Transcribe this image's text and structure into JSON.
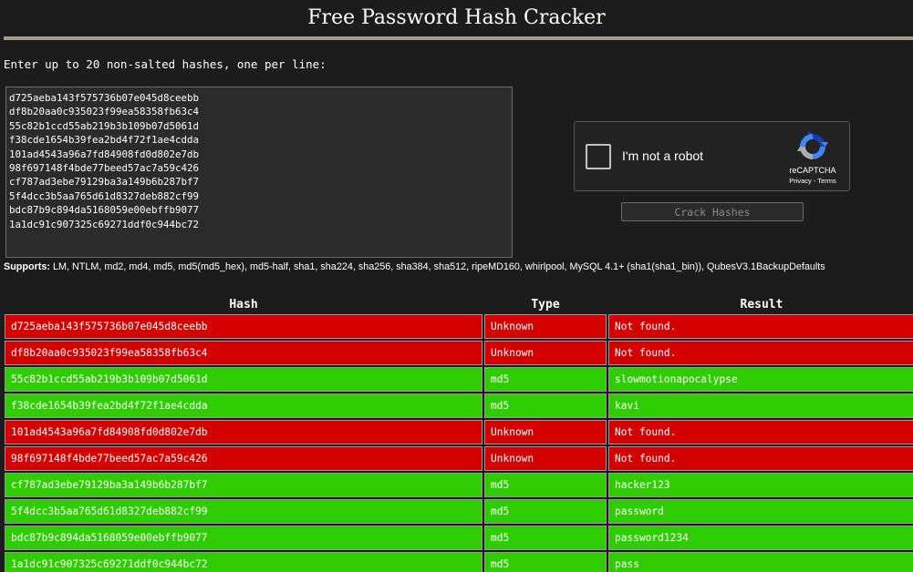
{
  "page": {
    "title": "Free Password Hash Cracker",
    "instructions": "Enter up to 20 non-salted hashes, one per line:"
  },
  "hash_input": {
    "value": "d725aeba143f575736b07e045d8ceebb\ndf8b20aa0c935023f99ea58358fb63c4\n55c82b1ccd55ab219b3b109b07d5061d\nf38cde1654b39fea2bd4f72f1ae4cdda\n101ad4543a96a7fd84908fd0d802e7db\n98f697148f4bde77beed57ac7a59c426\ncf787ad3ebe79129ba3a149b6b287bf7\n5f4dcc3b5aa765d61d8327deb882cf99\nbdc87b9c894da5168059e00ebffb9077\n1a1dc91c907325c69271ddf0c944bc72"
  },
  "captcha": {
    "label": "I'm not a robot",
    "brand": "reCAPTCHA",
    "links": "Privacy - Terms",
    "icon": "recaptcha-logo"
  },
  "crack_button": {
    "label": "Crack Hashes"
  },
  "supports": {
    "label": "Supports:",
    "text": "LM, NTLM, md2, md4, md5, md5(md5_hex), md5-half, sha1, sha224, sha256, sha384, sha512, ripeMD160, whirlpool, MySQL 4.1+ (sha1(sha1_bin)), QubesV3.1BackupDefaults"
  },
  "results": {
    "headers": {
      "hash": "Hash",
      "type": "Type",
      "result": "Result"
    },
    "rows": [
      {
        "hash": "d725aeba143f575736b07e045d8ceebb",
        "type": "Unknown",
        "result": "Not found.",
        "status": "fail"
      },
      {
        "hash": "df8b20aa0c935023f99ea58358fb63c4",
        "type": "Unknown",
        "result": "Not found.",
        "status": "fail"
      },
      {
        "hash": "55c82b1ccd55ab219b3b109b07d5061d",
        "type": "md5",
        "result": "slowmotionapocalypse",
        "status": "ok"
      },
      {
        "hash": "f38cde1654b39fea2bd4f72f1ae4cdda",
        "type": "md5",
        "result": "kavi",
        "status": "ok"
      },
      {
        "hash": "101ad4543a96a7fd84908fd0d802e7db",
        "type": "Unknown",
        "result": "Not found.",
        "status": "fail"
      },
      {
        "hash": "98f697148f4bde77beed57ac7a59c426",
        "type": "Unknown",
        "result": "Not found.",
        "status": "fail"
      },
      {
        "hash": "cf787ad3ebe79129ba3a149b6b287bf7",
        "type": "md5",
        "result": "hacker123",
        "status": "ok"
      },
      {
        "hash": "5f4dcc3b5aa765d61d8327deb882cf99",
        "type": "md5",
        "result": "password",
        "status": "ok"
      },
      {
        "hash": "bdc87b9c894da5168059e00ebffb9077",
        "type": "md5",
        "result": "password1234",
        "status": "ok"
      },
      {
        "hash": "1a1dc91c907325c69271ddf0c944bc72",
        "type": "md5",
        "result": "pass",
        "status": "ok"
      }
    ]
  },
  "colors": {
    "background": "#1c1c1c",
    "title_rule": "#a59c8c",
    "fail_row": "#d40000",
    "ok_row": "#2fcd00"
  }
}
